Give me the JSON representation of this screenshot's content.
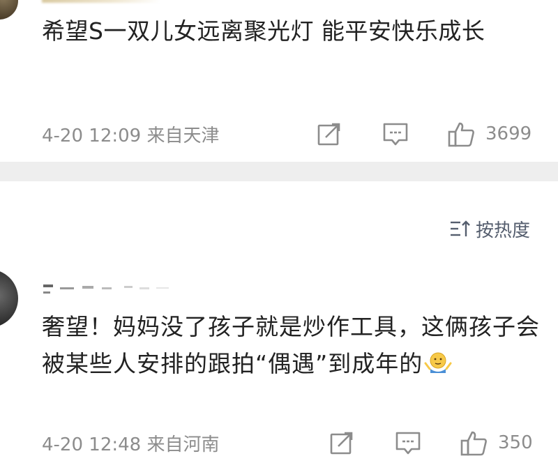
{
  "comments": [
    {
      "text": "希望S一双儿女远离聚光灯 能平安快乐成长",
      "time": "4-20 12:09",
      "source": "来自天津",
      "likes": "3699",
      "icons": [
        "share-icon",
        "comment-icon",
        "like-icon"
      ]
    },
    {
      "text": "奢望！妈妈没了孩子就是炒作工具，这俩孩子会被某些人安排的跟拍“偶遇”到成年的",
      "emoji": "shrug-emoji",
      "time": "4-20 12:48",
      "source": "来自河南",
      "likes": "350",
      "icons": [
        "share-icon",
        "comment-icon",
        "like-icon"
      ]
    }
  ],
  "sort": {
    "label": "按热度",
    "icon": "sort-icon"
  },
  "colors": {
    "text": "#222222",
    "meta": "#8c8c8c",
    "divider": "#eeeeee",
    "sort": "#555e6e"
  }
}
